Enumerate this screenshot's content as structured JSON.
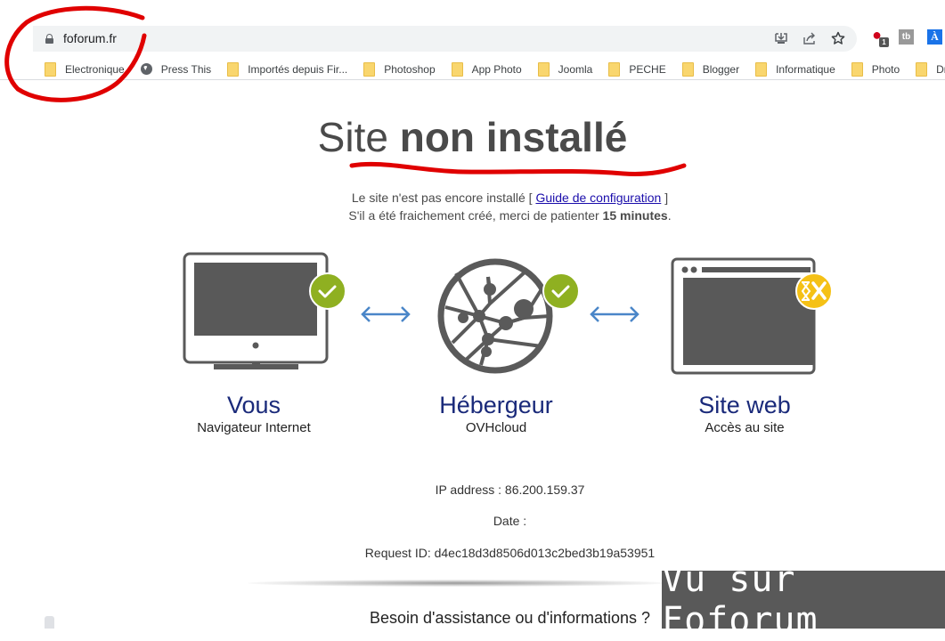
{
  "browser": {
    "url": "foforum.fr",
    "omnibox_icons": [
      "install-icon",
      "share-icon",
      "bookmark-star-icon"
    ],
    "extensions": [
      {
        "name": "opera-extension",
        "badge": "1"
      },
      {
        "name": "tb-extension",
        "label": "tb"
      },
      {
        "name": "translate-extension",
        "label": "À"
      }
    ],
    "bookmarks": [
      {
        "label": "Electronique",
        "icon": "folder"
      },
      {
        "label": "Press This",
        "icon": "globe"
      },
      {
        "label": "Importés depuis Fir...",
        "icon": "folder"
      },
      {
        "label": "Photoshop",
        "icon": "folder"
      },
      {
        "label": "App Photo",
        "icon": "folder"
      },
      {
        "label": "Joomla",
        "icon": "folder"
      },
      {
        "label": "PECHE",
        "icon": "folder"
      },
      {
        "label": "Blogger",
        "icon": "folder"
      },
      {
        "label": "Informatique",
        "icon": "folder"
      },
      {
        "label": "Photo",
        "icon": "folder"
      },
      {
        "label": "Drupa",
        "icon": "folder"
      }
    ]
  },
  "page": {
    "title_light": "Site ",
    "title_bold": "non installé",
    "intro_line1_prefix": "Le site n'est pas encore installé [ ",
    "intro_link": "Guide de configuration",
    "intro_line1_suffix": " ]",
    "intro_line2_prefix": "S'il a été fraichement créé, merci de patienter ",
    "intro_line2_bold": "15 minutes",
    "intro_line2_suffix": ".",
    "tiles": [
      {
        "title": "Vous",
        "subtitle": "Navigateur Internet",
        "status": "ok"
      },
      {
        "title": "Hébergeur",
        "subtitle": "OVHcloud",
        "status": "ok"
      },
      {
        "title": "Site web",
        "subtitle": "Accès au site",
        "status": "pending"
      }
    ],
    "ip_label": "IP address : 86.200.159.37",
    "date_label": "Date :",
    "request_label": "Request ID: d4ec18d3d8506d013c2bed3b19a53951",
    "help": "Besoin d'assistance ou d'informations ?"
  },
  "colors": {
    "ok": "#8fb021",
    "pending": "#f5c116",
    "arrow": "#4a86c8",
    "annotation": "#e00000"
  },
  "watermark": "Vu sur Foforum"
}
